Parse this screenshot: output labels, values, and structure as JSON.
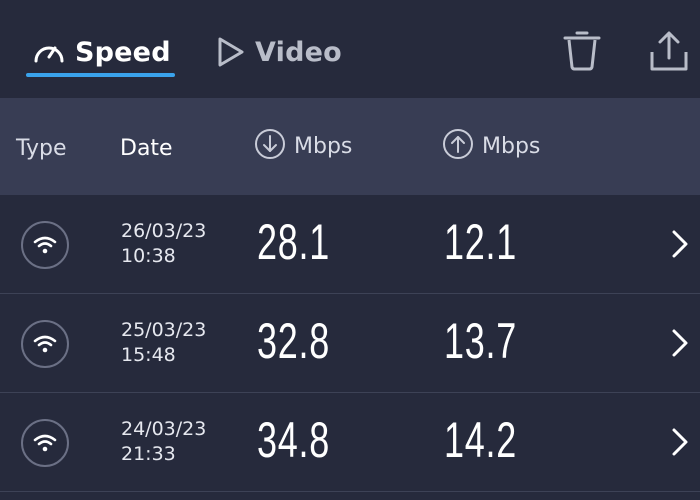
{
  "tabs": [
    {
      "label": "Speed",
      "icon": "speedometer-icon",
      "active": true
    },
    {
      "label": "Video",
      "icon": "play-icon",
      "active": false
    }
  ],
  "actions": [
    {
      "icon": "trash-icon"
    },
    {
      "icon": "share-icon"
    }
  ],
  "columns": {
    "type": "Type",
    "date": "Date",
    "download": "Mbps",
    "upload": "Mbps"
  },
  "results": [
    {
      "type_icon": "wifi-icon",
      "date": "26/03/23",
      "time": "10:38",
      "download": "28.1",
      "upload": "12.1"
    },
    {
      "type_icon": "wifi-icon",
      "date": "25/03/23",
      "time": "15:48",
      "download": "32.8",
      "upload": "13.7"
    },
    {
      "type_icon": "wifi-icon",
      "date": "24/03/23",
      "time": "21:33",
      "download": "34.8",
      "upload": "14.2"
    }
  ],
  "colors": {
    "background": "#262a3c",
    "header_band": "#383d54",
    "accent": "#3aa3ec"
  }
}
